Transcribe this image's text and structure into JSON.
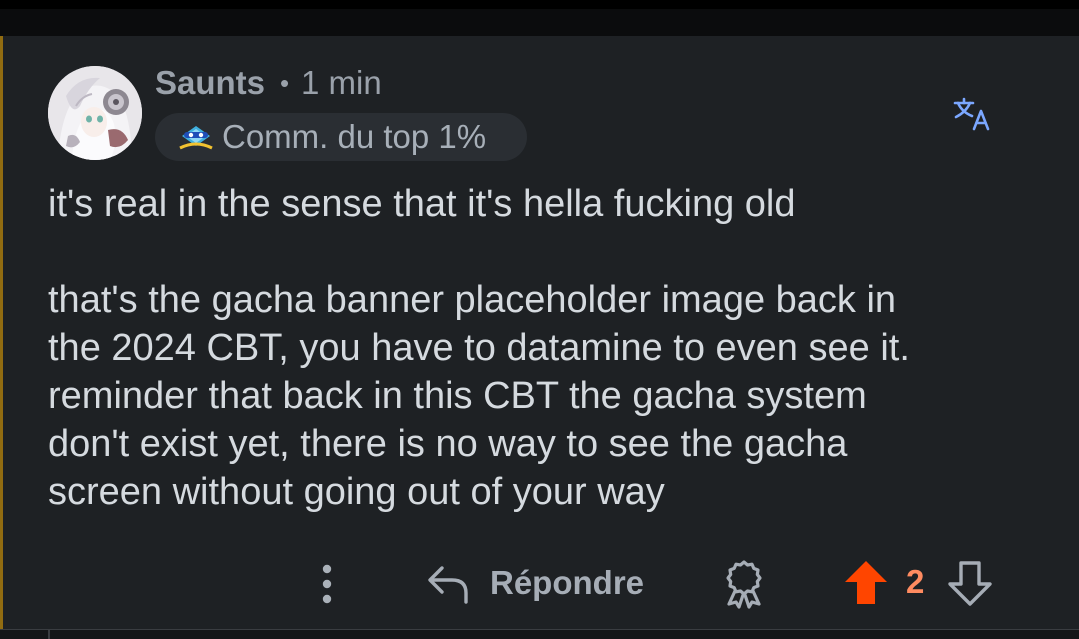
{
  "comment": {
    "author": "Saunts",
    "separator": "•",
    "time": "1 min",
    "badge": {
      "label": "Comm. du top 1%",
      "icon": "top-commenter-badge-icon"
    },
    "translate_icon": "translate-icon",
    "body_lines": [
      "it's real in the sense that it's hella fucking old",
      "that's the gacha banner placeholder image back in",
      "the 2024 CBT, you have to datamine to even see it.",
      "reminder that back in this CBT the gacha system",
      "don't exist yet, there is no way to see the gacha",
      "screen without going out of your way"
    ]
  },
  "actions": {
    "more_icon": "more-vertical-icon",
    "reply_label": "Répondre",
    "reply_icon": "reply-arrow-icon",
    "award_icon": "award-icon",
    "upvote_icon": "upvote-arrow-icon",
    "vote_count": "2",
    "downvote_icon": "downvote-arrow-icon"
  },
  "colors": {
    "background": "#1e2124",
    "text": "#d5dadf",
    "muted": "#9aa1aa",
    "upvote": "#ff4500",
    "vote_count": "#ff8b60",
    "badge_bg": "#2a2e33",
    "translate": "#7ba7ff",
    "thread_line": "#b8860b"
  }
}
